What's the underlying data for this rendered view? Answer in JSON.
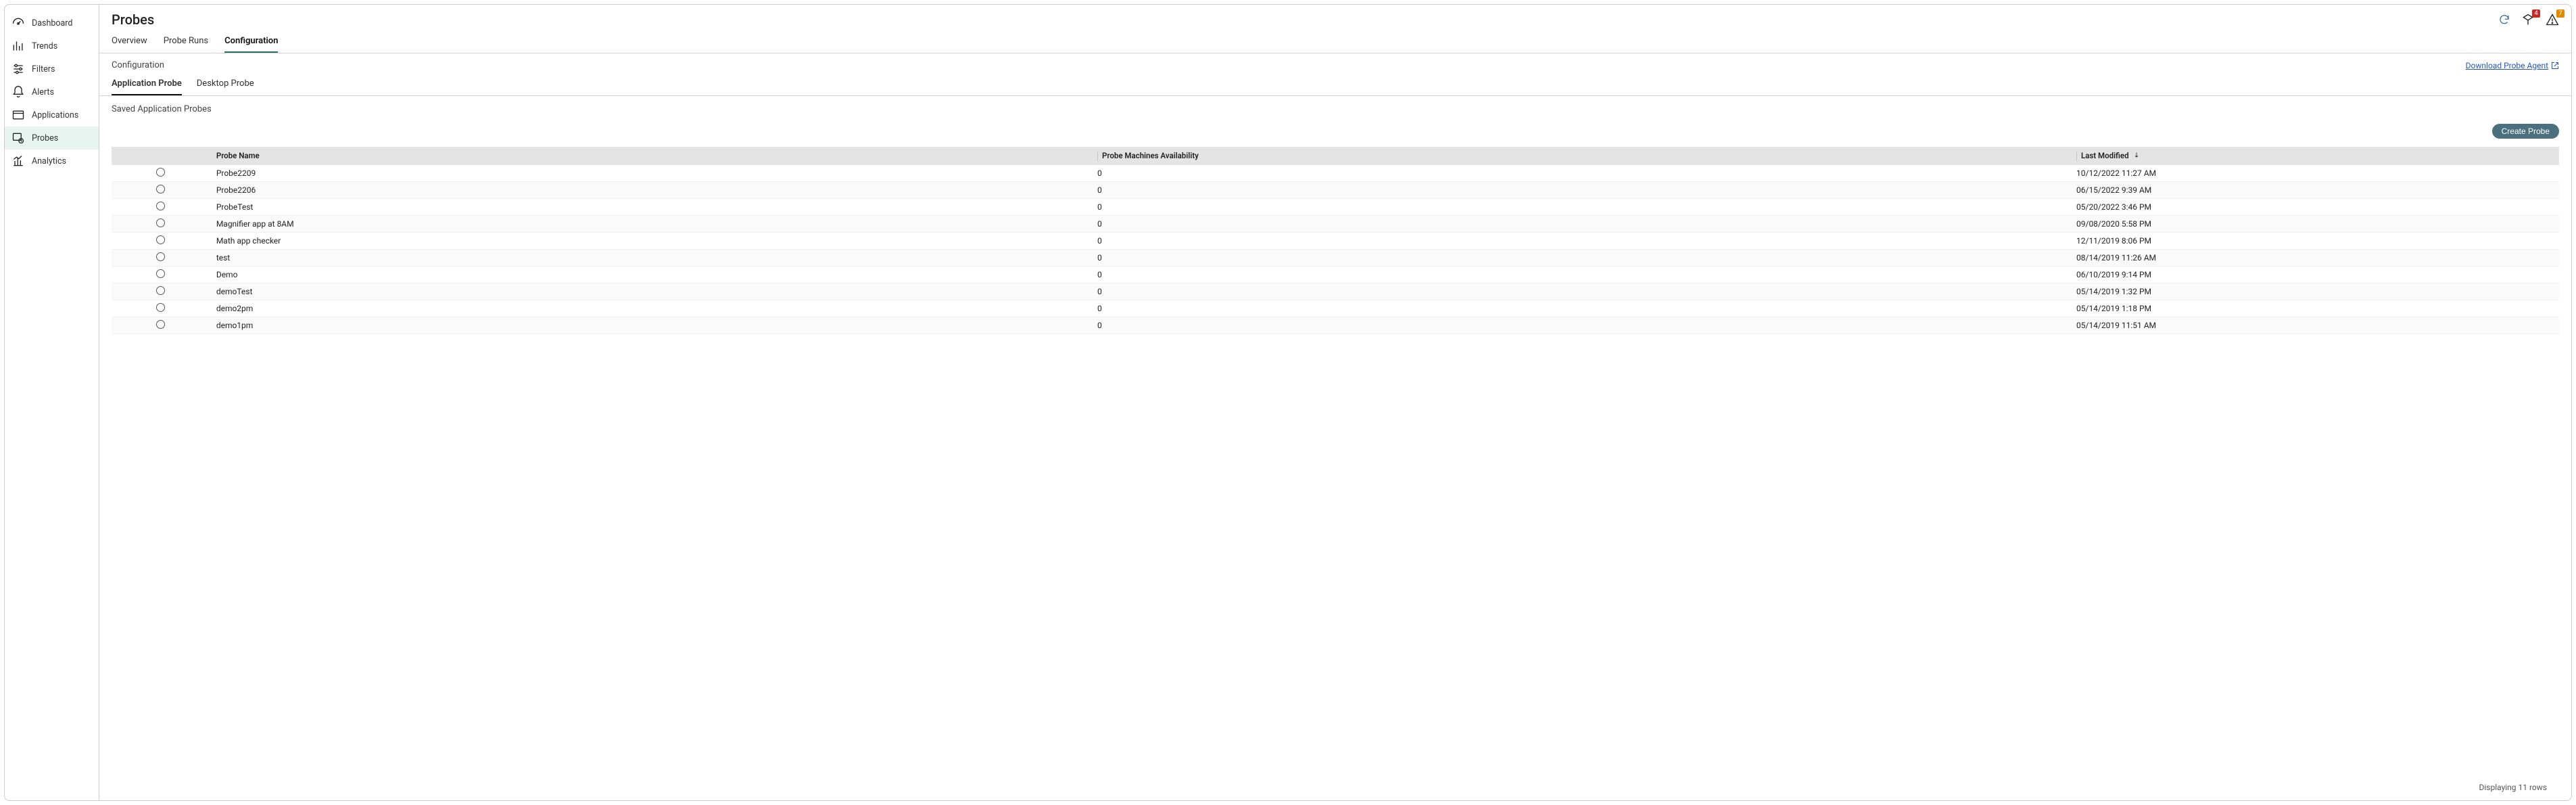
{
  "sidebar": {
    "items": [
      {
        "label": "Dashboard"
      },
      {
        "label": "Trends"
      },
      {
        "label": "Filters"
      },
      {
        "label": "Alerts"
      },
      {
        "label": "Applications"
      },
      {
        "label": "Probes"
      },
      {
        "label": "Analytics"
      }
    ]
  },
  "header": {
    "title": "Probes",
    "badges": {
      "tagCount": "4",
      "warnCount": "7"
    }
  },
  "tabs": [
    {
      "label": "Overview"
    },
    {
      "label": "Probe Runs"
    },
    {
      "label": "Configuration"
    }
  ],
  "config": {
    "label": "Configuration",
    "downloadLink": "Download Probe Agent"
  },
  "subtabs": [
    {
      "label": "Application Probe"
    },
    {
      "label": "Desktop Probe"
    }
  ],
  "sectionLabel": "Saved Application Probes",
  "createButton": "Create Probe",
  "table": {
    "columns": {
      "name": "Probe Name",
      "avail": "Probe Machines Availability",
      "mod": "Last Modified"
    },
    "rows": [
      {
        "name": "Probe2209",
        "avail": "0",
        "mod": "10/12/2022 11:27 AM"
      },
      {
        "name": "Probe2206",
        "avail": "0",
        "mod": "06/15/2022 9:39 AM"
      },
      {
        "name": "ProbeTest",
        "avail": "0",
        "mod": "05/20/2022 3:46 PM"
      },
      {
        "name": "Magnifier app at 8AM",
        "avail": "0",
        "mod": "09/08/2020 5:58 PM"
      },
      {
        "name": "Math app checker",
        "avail": "0",
        "mod": "12/11/2019 8:06 PM"
      },
      {
        "name": "test",
        "avail": "0",
        "mod": "08/14/2019 11:26 AM"
      },
      {
        "name": "Demo",
        "avail": "0",
        "mod": "06/10/2019 9:14 PM"
      },
      {
        "name": "demoTest",
        "avail": "0",
        "mod": "05/14/2019 1:32 PM"
      },
      {
        "name": "demo2pm",
        "avail": "0",
        "mod": "05/14/2019 1:18 PM"
      },
      {
        "name": "demo1pm",
        "avail": "0",
        "mod": "05/14/2019 11:51 AM"
      }
    ],
    "footer": "Displaying 11 rows"
  }
}
